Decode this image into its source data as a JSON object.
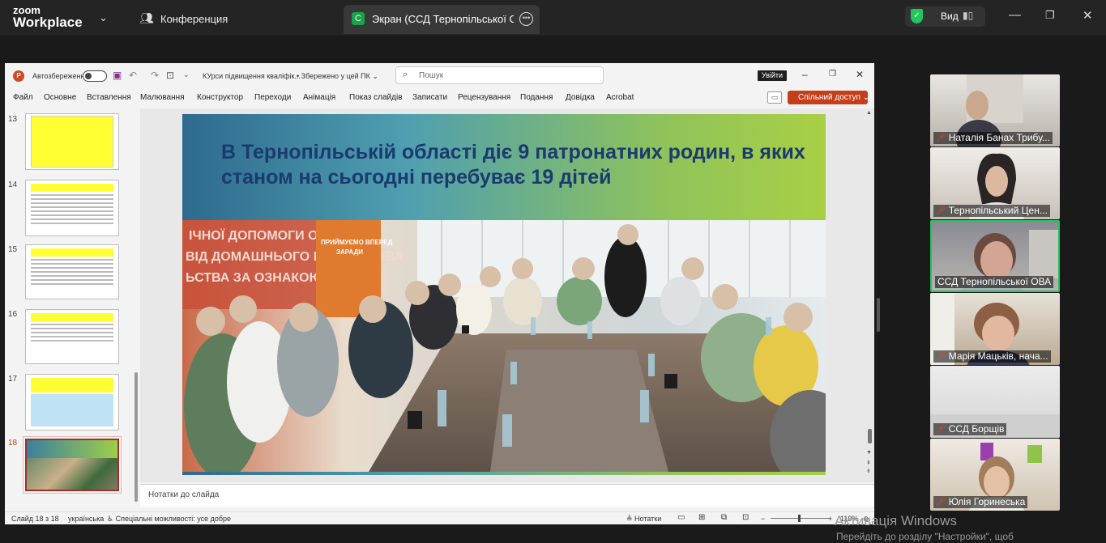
{
  "zoom": {
    "logo_top": "zoom",
    "logo_bottom": "Workplace",
    "meeting_label": "Конференция",
    "share_tab_badge": "C",
    "share_tab_label": "Экран (ССД Тернопільської ОВА",
    "view_label": "Вид",
    "icons": [
      "chevron-down-icon",
      "people-icon",
      "more-icon",
      "shield-icon",
      "grid-icon",
      "minimize-icon",
      "restore-icon",
      "close-icon"
    ]
  },
  "ppt": {
    "autosave_label": "Автозбереження",
    "file_title": "КУрси підвищення кваліфік...",
    "saved_status": "Збережено у цей ПК",
    "search_placeholder": "Пошук",
    "login_label": "Увійти",
    "tabs": [
      "Файл",
      "Основне",
      "Вставлення",
      "Малювання",
      "Конструктор",
      "Переходи",
      "Анімація",
      "Показ слайдів",
      "Записати",
      "Рецензування",
      "Подання",
      "Довідка",
      "Acrobat"
    ],
    "share_access": "Спільний доступ",
    "thumb_numbers": [
      "13",
      "14",
      "15",
      "16",
      "17",
      "18"
    ],
    "slide_title": "В Тернопільській області  діє 9 патронатних родин, в яких станом на сьогодні перебуває 19 дітей",
    "photo_banner_1": "ПРИЙМУЄМО ВПЕРЕД",
    "photo_banner_2": "ЗАРАДИ",
    "photo_wall_1": "ІЧНОЇ ДОПОМОГИ ОСОБАМ,",
    "photo_wall_2": "ВІД ДОМАШНЬОГО НАСИЛЬСТВА",
    "photo_wall_3": "ЬСТВА ЗА ОЗНАКОЮ СТАТІ",
    "notes_label": "Нотатки до слайда",
    "status_slide": "Слайд 18 з 18",
    "status_lang": "українська",
    "status_access": "Спеціальні можливості: усе добре",
    "status_notes": "Нотатки",
    "status_zoom": "119%"
  },
  "participants": [
    {
      "name": "Наталія Банах Трибу..."
    },
    {
      "name": "Тернопільський Цен..."
    },
    {
      "name": "ССД Тернопільської ОВА"
    },
    {
      "name": "Марія Мацьків, нача..."
    },
    {
      "name": "ССД Борщів"
    },
    {
      "name": "Юлія Горинеська"
    }
  ],
  "windows_activation": {
    "line1": "Активація Windows",
    "line2": "Перейдіть до розділу \"Настройки\", щоб"
  },
  "colors": {
    "zoom_bg": "#242424",
    "ppt_accent": "#c43e1c",
    "active_speaker": "#22c55e",
    "slide_title": "#1b3b6f"
  }
}
